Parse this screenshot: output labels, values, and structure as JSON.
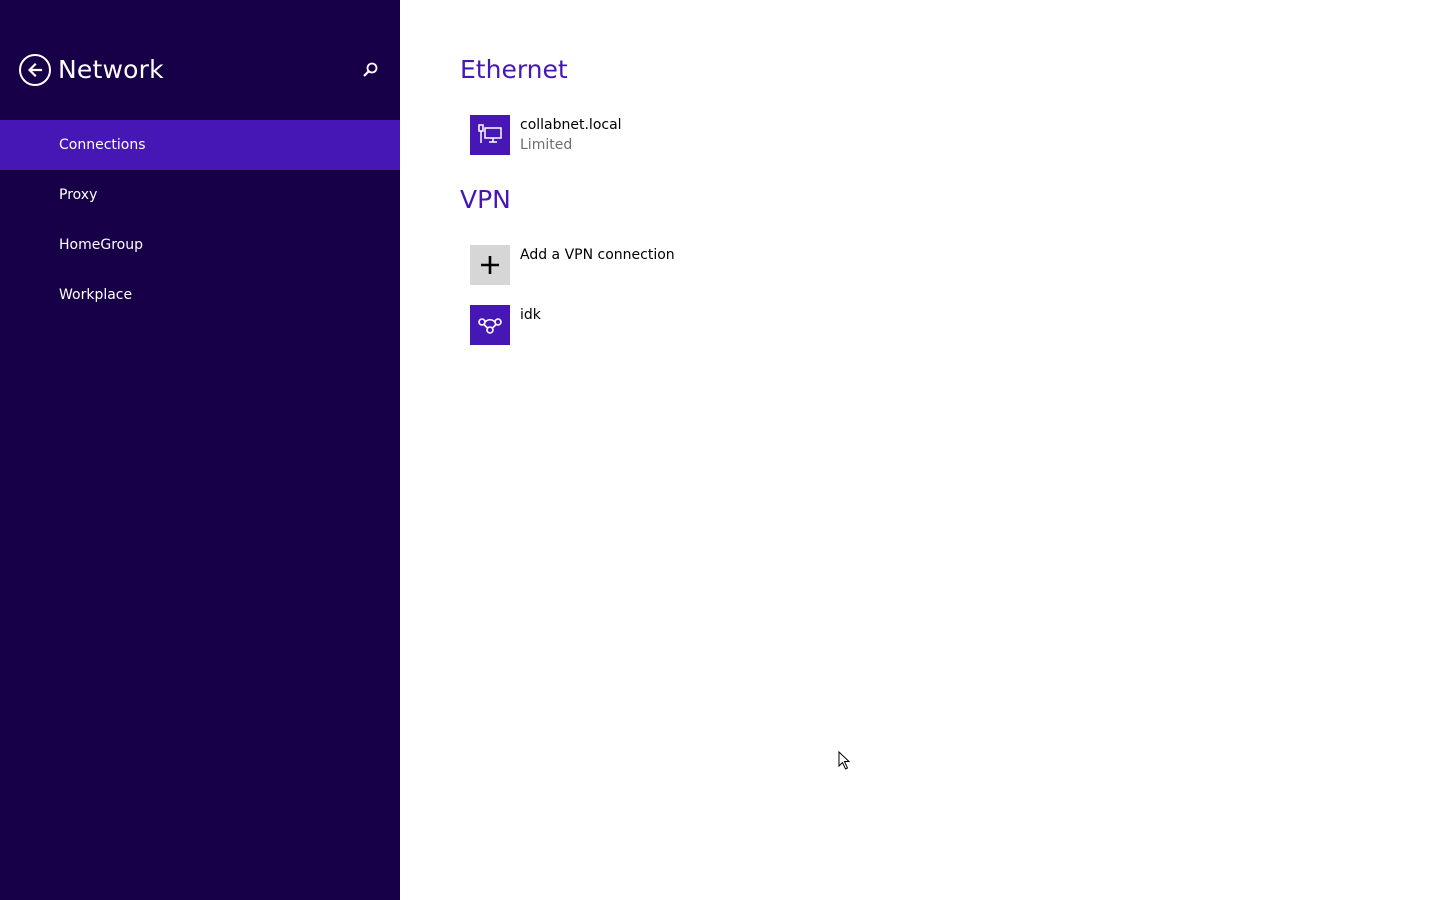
{
  "sidebar": {
    "title": "Network",
    "back_icon": "back-arrow-icon",
    "search_icon": "search-icon",
    "items": [
      {
        "label": "Connections",
        "active": true
      },
      {
        "label": "Proxy",
        "active": false
      },
      {
        "label": "HomeGroup",
        "active": false
      },
      {
        "label": "Workplace",
        "active": false
      }
    ]
  },
  "main": {
    "ethernet": {
      "title": "Ethernet",
      "connection": {
        "name": "collabnet.local",
        "status": "Limited",
        "icon": "ethernet-icon"
      }
    },
    "vpn": {
      "title": "VPN",
      "add_label": "Add a VPN connection",
      "add_icon": "plus-icon",
      "connections": [
        {
          "name": "idk",
          "icon": "vpn-icon"
        }
      ]
    }
  },
  "colors": {
    "sidebar_bg": "#170047",
    "accent": "#4617b4",
    "page_bg": "#ffffff"
  }
}
